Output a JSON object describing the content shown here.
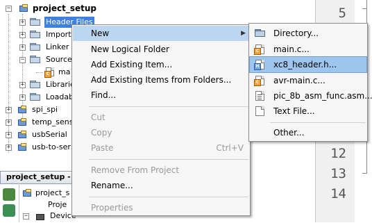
{
  "project_tree": {
    "root": {
      "label": "project_setup"
    },
    "children": [
      {
        "label": "Header Files",
        "selected": true
      },
      {
        "label": "Importa"
      },
      {
        "label": "Linker"
      },
      {
        "label": "Source"
      },
      {
        "label": "ma"
      },
      {
        "label": "Librarie"
      },
      {
        "label": "Loadab"
      }
    ],
    "projects": [
      {
        "label": "spi_spi"
      },
      {
        "label": "temp_sens"
      },
      {
        "label": "usbSerial"
      },
      {
        "label": "usb-to-ser"
      }
    ]
  },
  "editor": {
    "line_numbers": [
      "5",
      "12",
      "13",
      "14"
    ]
  },
  "navigator": {
    "tab_label": "project_setup -",
    "items": [
      {
        "label": "project_s"
      },
      {
        "label": "Proje"
      },
      {
        "label": "Device"
      }
    ]
  },
  "context_menu": {
    "items": [
      {
        "label": "New",
        "has_submenu": true
      },
      {
        "label": "New Logical Folder"
      },
      {
        "label": "Add Existing Item..."
      },
      {
        "label": "Add Existing Items from Folders..."
      },
      {
        "label": "Find..."
      },
      {
        "label": "Cut",
        "disabled": true
      },
      {
        "label": "Copy",
        "disabled": true
      },
      {
        "label": "Paste",
        "shortcut": "Ctrl+V",
        "disabled": true
      },
      {
        "label": "Remove From Project",
        "disabled": true
      },
      {
        "label": "Rename..."
      },
      {
        "label": "Properties",
        "disabled": true
      }
    ]
  },
  "submenu": {
    "items": [
      {
        "label": "Directory...",
        "icon": "folder-icon"
      },
      {
        "label": "main.c...",
        "icon": "c-file-icon"
      },
      {
        "label": "xc8_header.h...",
        "icon": "h-file-icon",
        "highlighted": true
      },
      {
        "label": "avr-main.c...",
        "icon": "c-file-icon"
      },
      {
        "label": "pic_8b_asm_func.asm...",
        "icon": "asm-file-icon"
      },
      {
        "label": "Text File...",
        "icon": "text-file-icon"
      },
      {
        "label": "Other...",
        "icon": ""
      }
    ]
  },
  "colors": {
    "selection": "#3d80df",
    "menu_hover": "#bcd5f0",
    "submenu_highlight": "#9ec5ee",
    "disabled_text": "#9a9a9a"
  }
}
